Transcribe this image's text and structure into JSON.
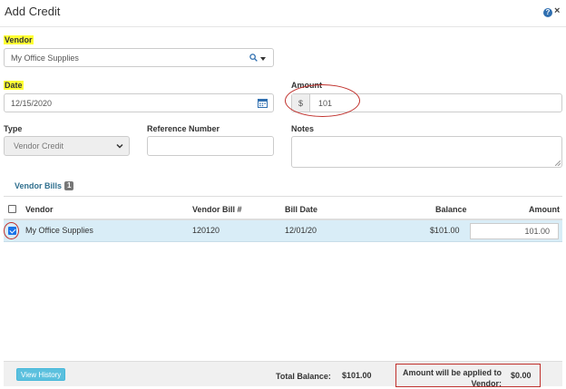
{
  "dialog": {
    "title": "Add Credit"
  },
  "vendor": {
    "label": "Vendor",
    "value": "My Office Supplies"
  },
  "date": {
    "label": "Date",
    "value": "12/15/2020"
  },
  "amount": {
    "label": "Amount",
    "currency": "$",
    "value": "101"
  },
  "type": {
    "label": "Type",
    "selected": "Vendor Credit"
  },
  "reference": {
    "label": "Reference Number",
    "value": ""
  },
  "notes": {
    "label": "Notes",
    "value": ""
  },
  "vendor_bills": {
    "title": "Vendor Bills",
    "count": "1",
    "columns": {
      "vendor": "Vendor",
      "bill_no": "Vendor Bill #",
      "bill_date": "Bill Date",
      "balance": "Balance",
      "amount": "Amount"
    },
    "rows": [
      {
        "vendor": "My Office Supplies",
        "bill_no": "120120",
        "bill_date": "12/01/20",
        "balance": "$101.00",
        "amount": "101.00",
        "checked": true
      }
    ]
  },
  "footer": {
    "view_history": "View History",
    "total_balance_label": "Total Balance:",
    "total_balance_value": "$101.00",
    "applied_label": "Amount will be applied to Vendor:",
    "applied_value": "$0.00"
  },
  "colors": {
    "accent": "#31708f",
    "highlight": "#ffff33",
    "selected_row": "#d9edf7",
    "annotation": "#c0302c",
    "info_button": "#5bc0de"
  },
  "icons": {
    "help": "question-circle-icon",
    "close": "close-icon",
    "search": "search-icon",
    "calendar": "calendar-icon"
  }
}
